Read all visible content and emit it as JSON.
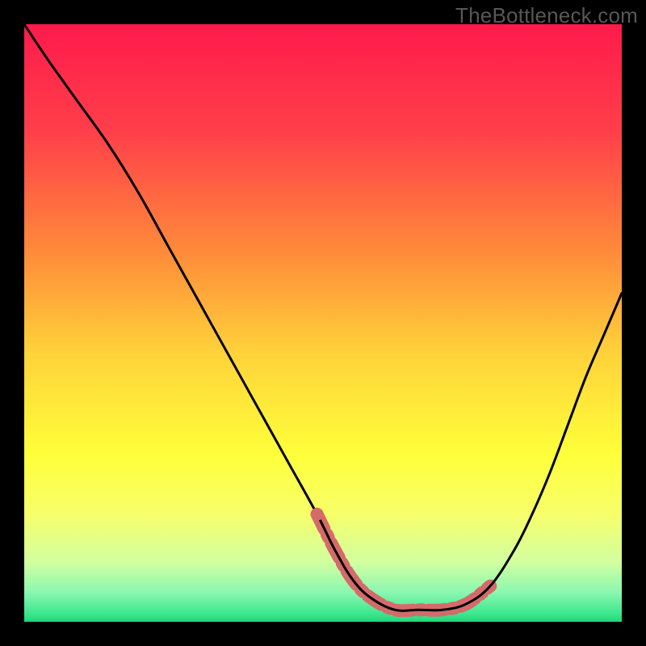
{
  "watermark": "TheBottleneck.com",
  "chart_data": {
    "type": "line",
    "title": "",
    "xlabel": "",
    "ylabel": "",
    "xlim": [
      0,
      100
    ],
    "ylim": [
      0,
      100
    ],
    "gradient_stops": [
      {
        "pos": 0.0,
        "color": "#ff1a4b"
      },
      {
        "pos": 0.18,
        "color": "#ff3f4a"
      },
      {
        "pos": 0.38,
        "color": "#ff8a3a"
      },
      {
        "pos": 0.55,
        "color": "#ffd23a"
      },
      {
        "pos": 0.72,
        "color": "#ffff3a"
      },
      {
        "pos": 0.82,
        "color": "#f7ff6a"
      },
      {
        "pos": 0.9,
        "color": "#d2ffa0"
      },
      {
        "pos": 0.95,
        "color": "#8cf7b0"
      },
      {
        "pos": 0.985,
        "color": "#3fe88f"
      },
      {
        "pos": 1.0,
        "color": "#1fd67a"
      }
    ],
    "series": [
      {
        "name": "bottleneck-curve",
        "x": [
          0,
          4,
          9,
          14,
          19,
          24,
          29,
          34,
          39,
          44,
          49,
          52,
          55,
          58,
          62,
          66,
          70,
          74,
          78,
          82,
          85,
          88,
          91,
          94,
          97,
          100
        ],
        "y": [
          100,
          94,
          87,
          80,
          72,
          63,
          54,
          45,
          36,
          27,
          18,
          12,
          7,
          4,
          2,
          2,
          2,
          3,
          6,
          12,
          18,
          25,
          33,
          41,
          48,
          55
        ]
      },
      {
        "name": "optimal-range-highlight",
        "x": [
          49,
          52,
          55,
          58,
          62,
          66,
          70,
          74,
          78
        ],
        "y": [
          18,
          12,
          7,
          4,
          2,
          2,
          2,
          3,
          6
        ]
      }
    ],
    "highlight_color": "#d56a6a",
    "curve_color": "#000000"
  }
}
